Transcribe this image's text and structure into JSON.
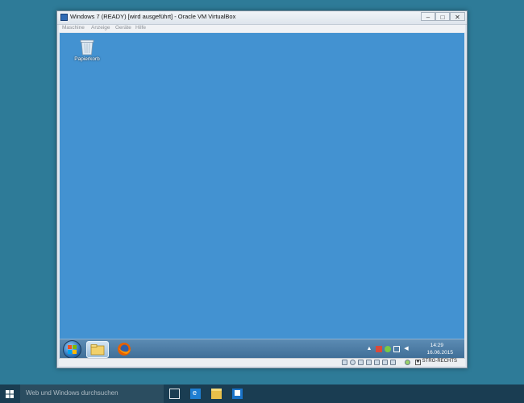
{
  "window": {
    "title": "Windows 7 (READY) [wird ausgeführt] - Oracle VM VirtualBox",
    "minimize_glyph": "–",
    "maximize_glyph": "□",
    "close_glyph": "✕"
  },
  "menubar": {
    "items": [
      "Maschine",
      "Anzeige",
      "Geräte",
      "Hilfe"
    ]
  },
  "guest": {
    "desktop_color": "#4392d1",
    "recycle_bin_label": "Papierkorb",
    "taskbar": {
      "pinned": [
        "windows-explorer-icon",
        "firefox-icon"
      ],
      "tray_up_glyph": "▲",
      "clock_time": "14:29",
      "clock_date": "16.06.2015"
    }
  },
  "statusbar": {
    "host_key_label": "STRG-RECHTS"
  },
  "host_taskbar": {
    "search_placeholder": "Web und Windows durchsuchen",
    "apps": [
      "task-view-icon",
      "edge-icon",
      "file-explorer-icon",
      "outlook-icon"
    ]
  }
}
